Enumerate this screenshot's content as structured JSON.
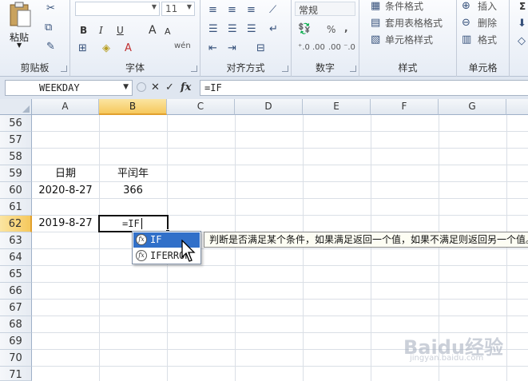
{
  "ribbon": {
    "clipboard": {
      "paste_label": "粘贴",
      "group_label": "剪贴板"
    },
    "font": {
      "size": "11",
      "group_label": "字体",
      "bold": "B",
      "italic": "I",
      "underline": "U",
      "grow": "A",
      "shrink": "A",
      "wen": "wén"
    },
    "alignment": {
      "group_label": "对齐方式"
    },
    "number": {
      "format": "常规",
      "group_label": "数字",
      "percent": "%",
      "comma": ","
    },
    "styles": {
      "conditional": "条件格式",
      "table_format": "套用表格格式",
      "cell_styles": "单元格样式",
      "group_label": "样式"
    },
    "cells": {
      "insert": "插入",
      "delete": "删除",
      "format": "格式",
      "group_label": "单元格"
    },
    "editing": {
      "sigma": "Σ"
    }
  },
  "formula_bar": {
    "name_box": "WEEKDAY",
    "cancel": "✕",
    "enter": "✓",
    "fx": "fx",
    "formula": "=IF"
  },
  "columns": [
    "A",
    "B",
    "C",
    "D",
    "E",
    "F",
    "G"
  ],
  "selected_column": "B",
  "rows": [
    "56",
    "57",
    "58",
    "59",
    "60",
    "61",
    "62",
    "63",
    "64",
    "65",
    "66",
    "67",
    "68",
    "69",
    "70",
    "71"
  ],
  "selected_row": "62",
  "cells": {
    "A59": "日期",
    "B59": "平闰年",
    "A60": "2020-8-27",
    "B60": "366",
    "A62": "2019-8-27",
    "B62": "=IF"
  },
  "autocomplete": {
    "items": [
      {
        "icon": "fx",
        "label": "IF"
      },
      {
        "icon": "fx",
        "label": "IFERROR"
      }
    ],
    "tooltip": "判断是否满足某个条件，如果满足返回一个值，如果不满足则返回另一个值。"
  },
  "watermark": {
    "text": "Baidu经验",
    "sub": "jingyan.baidu.com"
  },
  "colors": {
    "selected_header": "#f6c85c",
    "highlight": "#3170c9",
    "ribbon_bg": "#e6ecf5"
  }
}
